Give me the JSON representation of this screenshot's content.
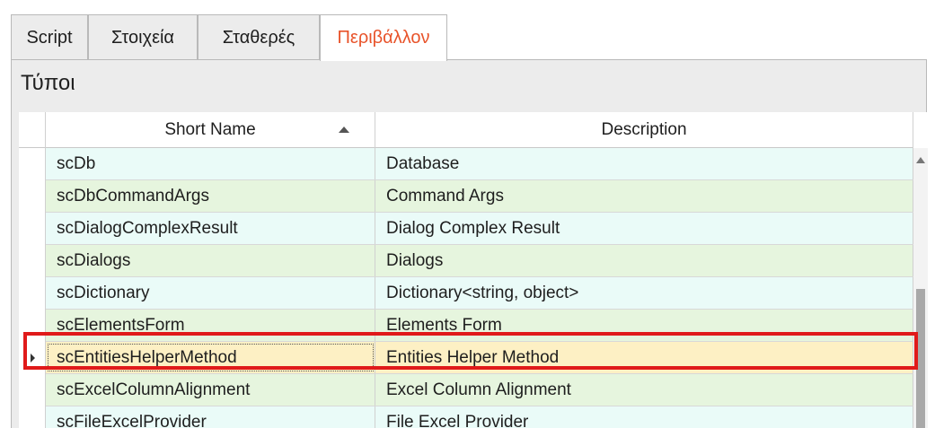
{
  "tabs": [
    {
      "label": "Script"
    },
    {
      "label": "Στοιχεία"
    },
    {
      "label": "Σταθερές"
    },
    {
      "label": "Περιβάλλον"
    }
  ],
  "active_tab": "Περιβάλλον",
  "group": {
    "title": "Τύποι"
  },
  "grid": {
    "columns": {
      "short_name": "Short Name",
      "description": "Description"
    },
    "sort": {
      "column": "Short Name",
      "direction": "ascending"
    },
    "rows": [
      {
        "short_name": "scDb",
        "description": "Database"
      },
      {
        "short_name": "scDbCommandArgs",
        "description": "Command Args"
      },
      {
        "short_name": "scDialogComplexResult",
        "description": "Dialog Complex Result"
      },
      {
        "short_name": "scDialogs",
        "description": "Dialogs"
      },
      {
        "short_name": "scDictionary",
        "description": "Dictionary<string, object>"
      },
      {
        "short_name": "scElementsForm",
        "description": "Elements Form"
      },
      {
        "short_name": "scEntitiesHelperMethod",
        "description": "Entities Helper Method"
      },
      {
        "short_name": "scExcelColumnAlignment",
        "description": "Excel Column Alignment"
      },
      {
        "short_name": "scFileExcelProvider",
        "description": "File Excel Provider"
      }
    ],
    "selected_row": "scEntitiesHelperMethod"
  },
  "colors": {
    "active_tab_text": "#e8532a",
    "row_alt_a": "#eafbf8",
    "row_alt_b": "#e6f5de",
    "row_selected": "#fdf0c4",
    "highlight_box": "#e01a1a"
  },
  "icons": {
    "sort": "sort-ascending-icon",
    "row_indicator": "row-pointer-icon",
    "scroll_up": "scroll-up-arrow-icon"
  }
}
